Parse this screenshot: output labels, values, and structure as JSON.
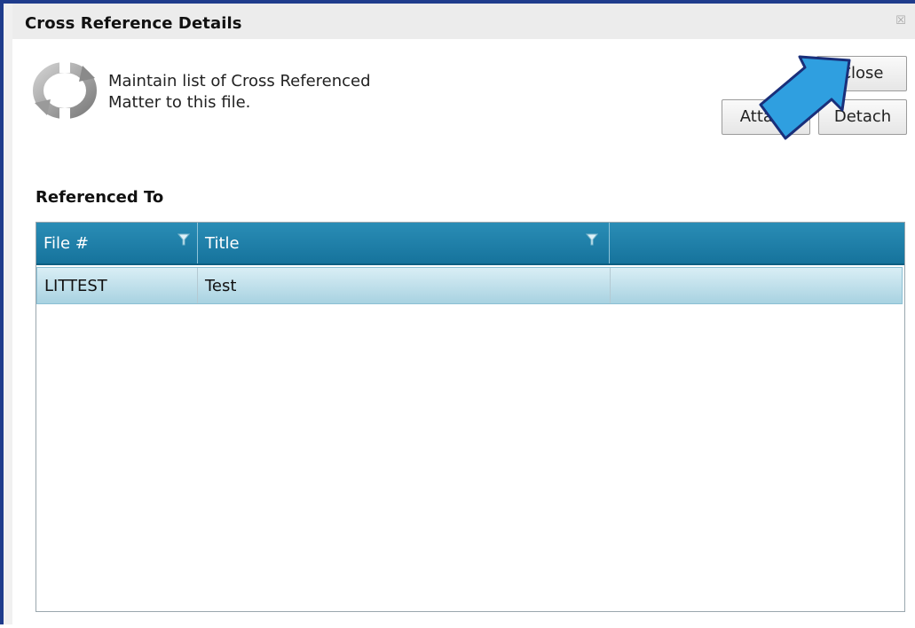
{
  "window": {
    "title": "Cross Reference Details",
    "close_glyph": "☒"
  },
  "header": {
    "icon": "refresh-cycle-icon",
    "description": "Maintain list of Cross Referenced Matter to this file."
  },
  "buttons": {
    "close_label": "Close",
    "attach_label": "Attach",
    "detach_label": "Detach"
  },
  "section": {
    "label": "Referenced To"
  },
  "grid": {
    "columns": [
      {
        "label": "File #",
        "filter_icon": "filter-icon"
      },
      {
        "label": "Title",
        "filter_icon": "filter-icon"
      },
      {
        "label": ""
      }
    ],
    "rows": [
      {
        "file": "LITTEST",
        "title": "Test",
        "extra": ""
      }
    ]
  },
  "colors": {
    "window_border": "#1f3c8c",
    "grid_header": "#1f80aa",
    "selected_row": "#bfe0ec",
    "pointer_arrow": "#2f9fe0"
  }
}
